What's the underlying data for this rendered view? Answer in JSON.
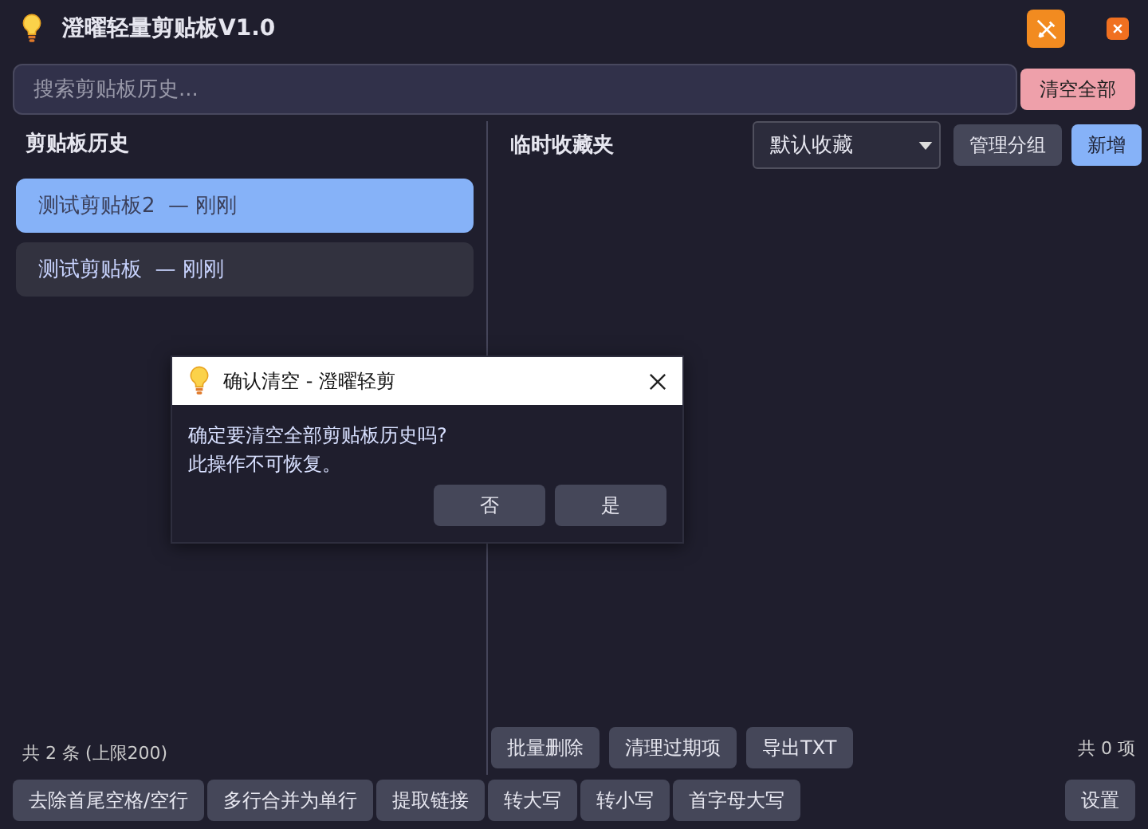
{
  "window": {
    "title": "澄曜轻量剪贴板V1.0"
  },
  "search": {
    "placeholder": "搜索剪贴板历史..."
  },
  "clear_all_button": "清空全部",
  "history": {
    "title": "剪贴板历史",
    "items": [
      {
        "text": "测试剪贴板2  — 刚刚",
        "selected": true
      },
      {
        "text": "测试剪贴板  — 刚刚",
        "selected": false
      }
    ],
    "count": "共 2 条 (上限200)"
  },
  "favorites": {
    "title": "临时收藏夹",
    "group_select": "默认收藏",
    "buttons": [
      {
        "label": "管理分组",
        "kind": "normal"
      },
      {
        "label": "新增",
        "kind": "primary"
      }
    ],
    "actions": [
      "批量删除",
      "清理过期项",
      "导出TXT"
    ],
    "count": "共 0 项"
  },
  "tools": [
    "去除首尾空格/空行",
    "多行合并为单行",
    "提取链接",
    "转大写",
    "转小写",
    "首字母大写"
  ],
  "settings_button": "设置",
  "dialog": {
    "title": "确认清空 - 澄曜轻剪",
    "message": "确定要清空全部剪贴板历史吗?\n此操作不可恢复。",
    "buttons": [
      "否",
      "是"
    ]
  }
}
